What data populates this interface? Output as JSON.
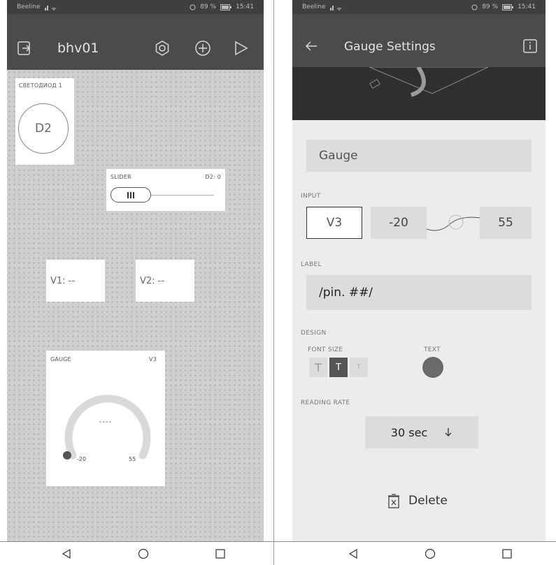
{
  "left": {
    "status": {
      "carrier": "Beeline",
      "battery": "89 %",
      "time": "15:41"
    },
    "appbar": {
      "title": "bhv01"
    },
    "led": {
      "label": "СВЕТОДИОД 1",
      "pin": "D2"
    },
    "slider": {
      "label": "SLIDER",
      "pin": "D2: 0",
      "value_fraction": 0.0
    },
    "value1": {
      "text": "V1: --"
    },
    "value2": {
      "text": "V2: --"
    },
    "gauge": {
      "label": "GAUGE",
      "pin": "V3",
      "value_text": "----",
      "min": "-20",
      "max": "55"
    }
  },
  "right": {
    "status": {
      "carrier": "Beeline",
      "battery": "89 %",
      "time": "15:41"
    },
    "appbar": {
      "title": "Gauge Settings"
    },
    "name_field": {
      "value": "Gauge"
    },
    "input": {
      "section": "INPUT",
      "pin": "V3",
      "min": "-20",
      "max": "55"
    },
    "label": {
      "section": "LABEL",
      "value": "/pin. ##/"
    },
    "design": {
      "section": "DESIGN",
      "font_size_label": "FONT SIZE",
      "text_label": "TEXT",
      "font_sizes": [
        "T",
        "T",
        "T"
      ],
      "selected_font_size": 1
    },
    "reading_rate": {
      "section": "READING RATE",
      "value": "30 sec"
    },
    "delete": {
      "label": "Delete"
    }
  },
  "colors": {
    "appbar": "#4b4b4b",
    "status": "#3f3f3f",
    "canvas": "#cfcfcf",
    "selected_font": "#555555",
    "text_color_swatch": "#6a6a6a"
  }
}
